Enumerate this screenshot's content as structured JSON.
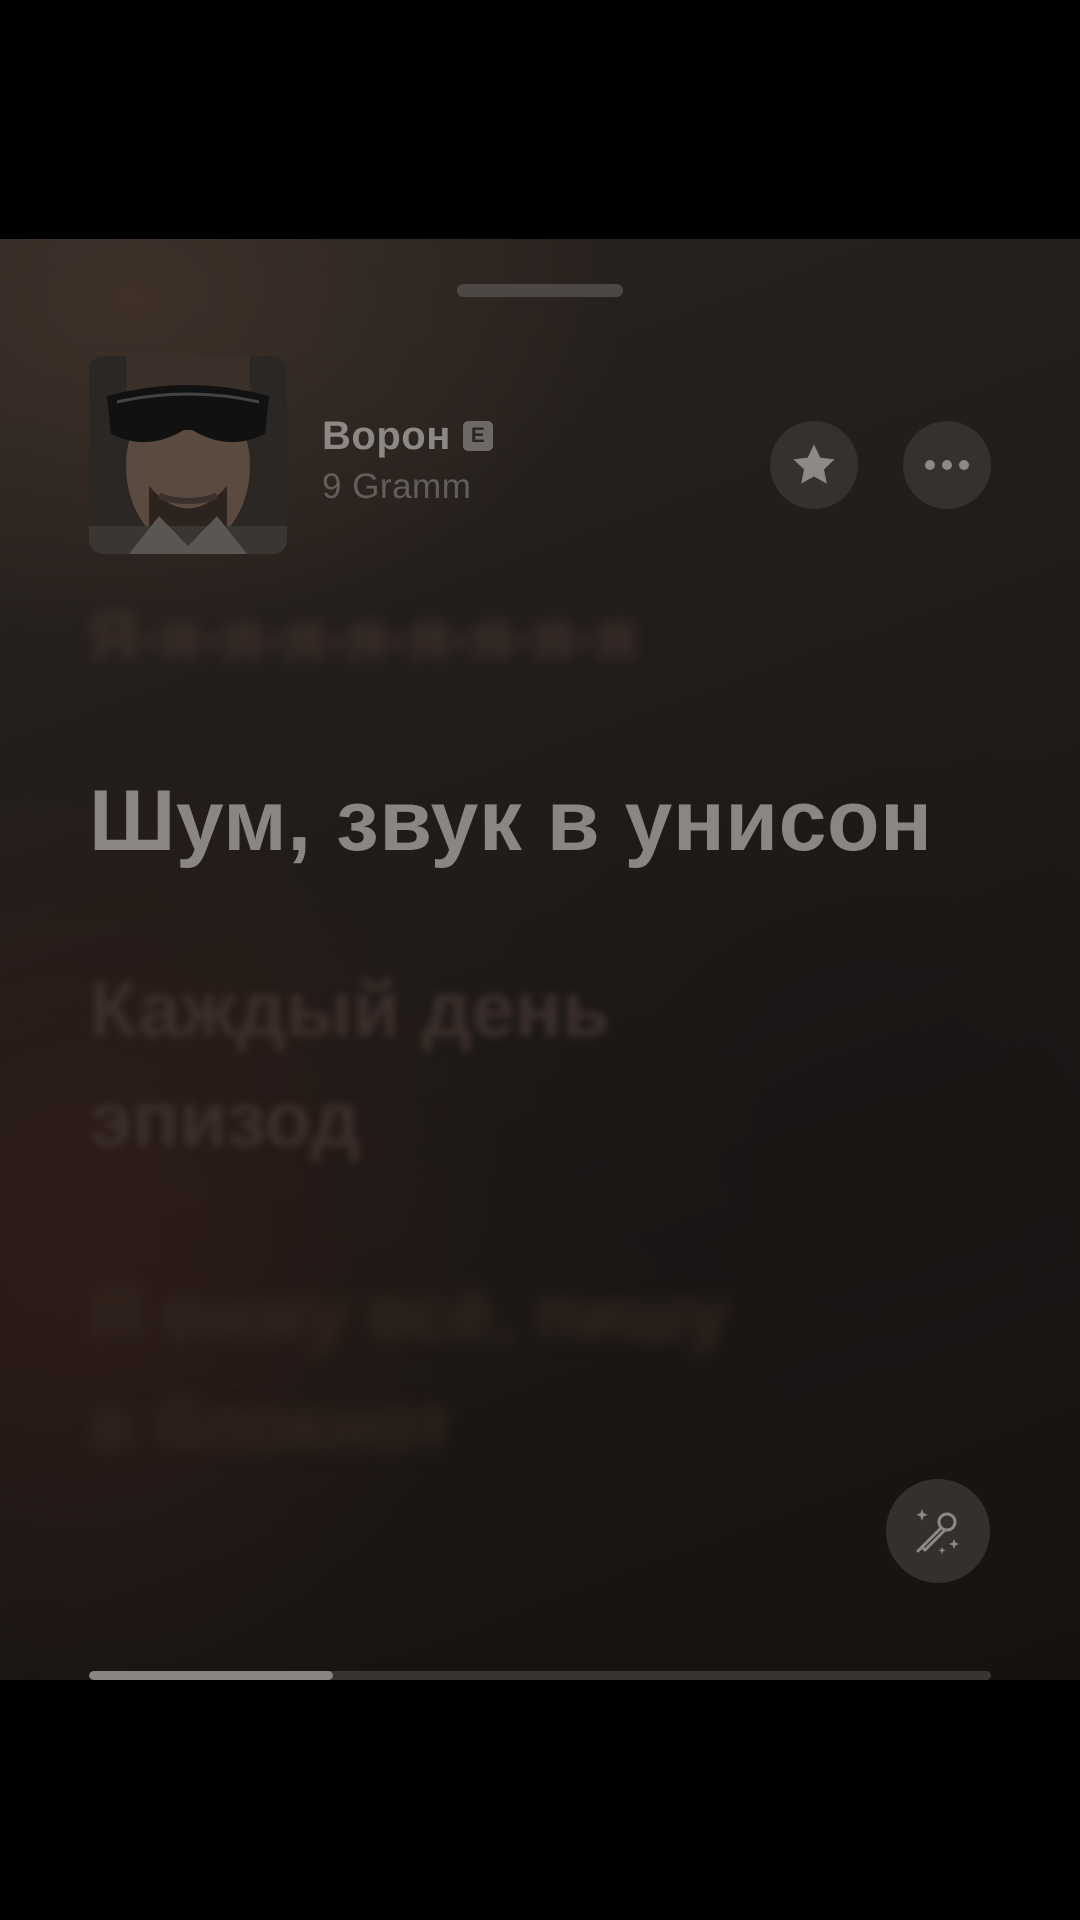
{
  "track": {
    "title": "Ворон",
    "explicit_badge": "E",
    "artist": "9 Gramm"
  },
  "icons": {
    "favorite": "star-icon",
    "more": "ellipsis-icon",
    "sing": "microphone-sparkles-icon"
  },
  "lyrics": {
    "previous": "Я-я-я-я-я-я-я-я-я",
    "current": "Шум, звук в унисон",
    "next_line1": "Каждый день",
    "next_line2": "эпизод",
    "next2_line1": "Я вижу всё, пишу",
    "next2_line2": "в блокнот"
  },
  "playback": {
    "progress_fraction": 0.27
  },
  "colors": {
    "background": "#211c19",
    "text_current": "#8a8684",
    "button_bg": "#37312e"
  }
}
